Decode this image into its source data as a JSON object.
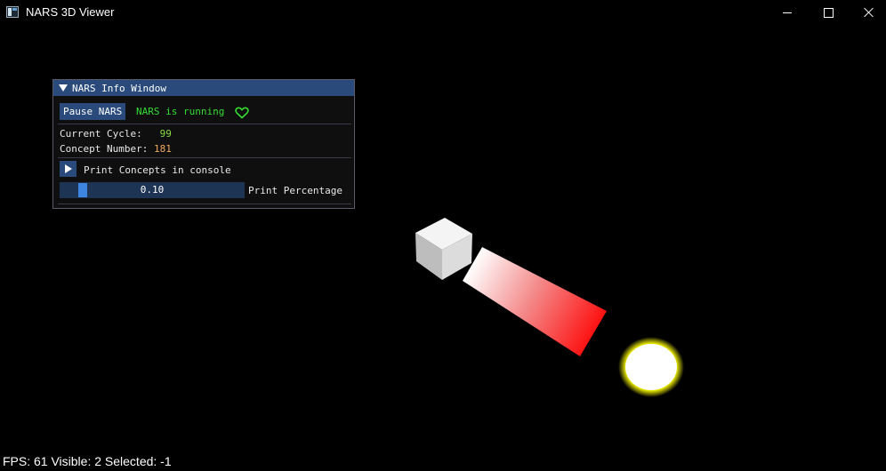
{
  "window": {
    "title": "NARS 3D Viewer"
  },
  "info_window": {
    "title": "NARS Info Window",
    "pause_button": "Pause NARS",
    "status_text": "NARS is running",
    "current_cycle_label": "Current Cycle:",
    "current_cycle_value": "99",
    "concept_number_label": "Concept Number:",
    "concept_number_value": "181",
    "print_concepts_label": "Print Concepts in console",
    "slider_value": "0.10",
    "slider_label": "Print Percentage"
  },
  "status_bar": {
    "text": "FPS: 61 Visible: 2 Selected: -1"
  },
  "colors": {
    "panel_title": "#294a7a",
    "running_green": "#33dd33",
    "cycle_green": "#88dd44",
    "concept_orange": "#f0a860",
    "beam_red": "#ff0000",
    "glow_yellow": "#e8e800"
  },
  "icons": [
    "app-icon",
    "minimize-icon",
    "maximize-icon",
    "close-icon",
    "collapse-arrow-icon",
    "heart-icon",
    "play-arrow-icon"
  ]
}
